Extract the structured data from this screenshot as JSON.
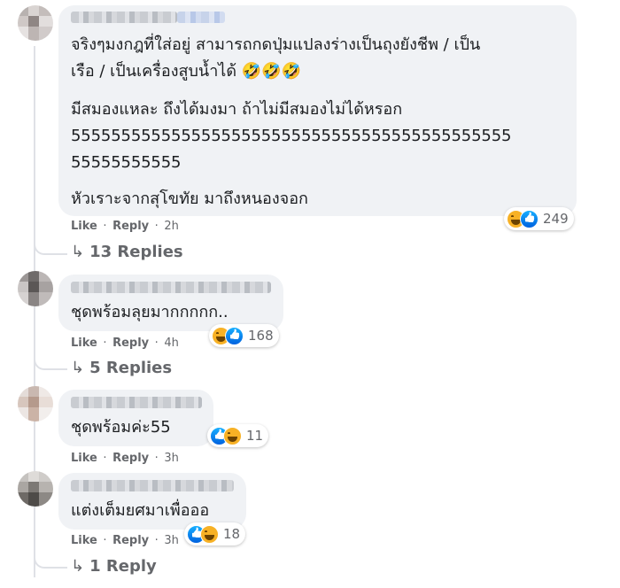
{
  "comments": [
    {
      "text_lines": [
        "จริงๆมงกฎที่ใส่อยู่ สามารถกดปุ่มแปลงร่างเป็นถุงยังชีพ / เป็น",
        "เรือ / เป็นเครื่องสูบน้ำได้ 🤣🤣🤣",
        "มีสมองแหละ ถึงได้มงมา ถ้าไม่มีสมองไม่ได้หรอก",
        "55555555555555555555555555555555555555555555",
        "55555555555",
        "หัวเราะจากสุโขทัย มาถึงหนองจอก"
      ],
      "like_label": "Like",
      "reply_label": "Reply",
      "time": "2h",
      "reaction_count": "249",
      "reactions": [
        "haha",
        "like"
      ],
      "replies_label": "13 Replies"
    },
    {
      "text": "ชุดพร้อมลุยมากกกกก..",
      "like_label": "Like",
      "reply_label": "Reply",
      "time": "4h",
      "reaction_count": "168",
      "reactions": [
        "haha",
        "like"
      ],
      "replies_label": "5 Replies"
    },
    {
      "text": "ชุดพร้อมค่ะ55",
      "like_label": "Like",
      "reply_label": "Reply",
      "time": "3h",
      "reaction_count": "11",
      "reactions": [
        "like",
        "haha"
      ]
    },
    {
      "text": "แต่งเต็มยศมาเพื่อออ",
      "like_label": "Like",
      "reply_label": "Reply",
      "time": "3h",
      "reaction_count": "18",
      "reactions": [
        "like",
        "haha"
      ],
      "replies_label": "1 Reply"
    }
  ],
  "meta_separator": "·",
  "reply_arrow": "↳",
  "colors": {
    "bubble": "#f0f2f5",
    "meta": "#65676b",
    "like_blue": "#1877f2",
    "haha_yellow": "#f7b125"
  }
}
